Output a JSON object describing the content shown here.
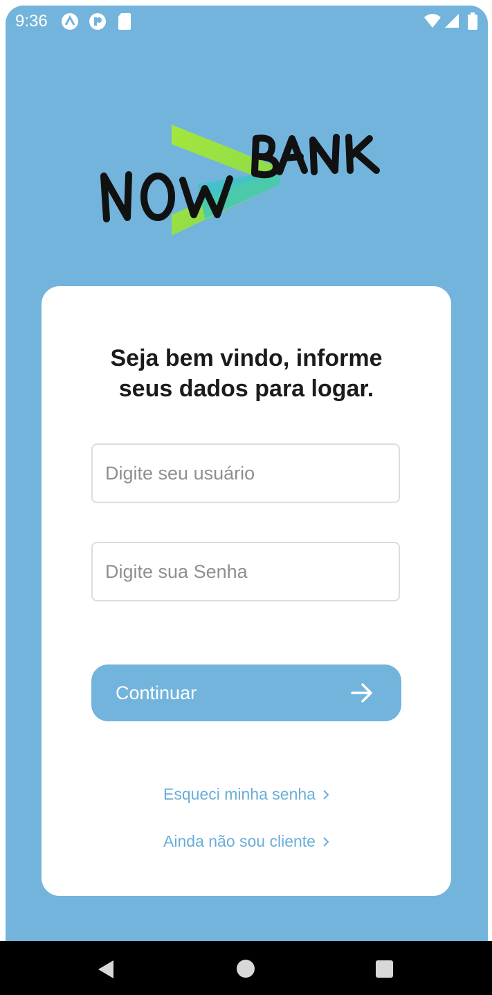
{
  "status_bar": {
    "time": "9:36",
    "left_icons": [
      "app-a-icon",
      "app-p-icon",
      "sd-card-icon"
    ],
    "right_icons": [
      "wifi-icon",
      "cell-signal-icon",
      "battery-icon"
    ]
  },
  "logo": {
    "brand_name": "NOW BANK",
    "accent_colors": [
      "#a6e63c",
      "#36c9c3"
    ]
  },
  "login": {
    "welcome_line1": "Seja bem vindo, informe",
    "welcome_line2": "seus dados para logar.",
    "username": {
      "value": "",
      "placeholder": "Digite seu usuário"
    },
    "password": {
      "value": "",
      "placeholder": "Digite sua Senha"
    },
    "continue_label": "Continuar",
    "forgot_password": "Esqueci minha senha",
    "not_client": "Ainda não sou cliente"
  },
  "nav": {
    "buttons": [
      "back-icon",
      "home-icon",
      "recents-icon"
    ]
  },
  "colors": {
    "background": "#72b4dc",
    "card": "#ffffff",
    "button": "#72b4dc",
    "link": "#6aaed8"
  }
}
